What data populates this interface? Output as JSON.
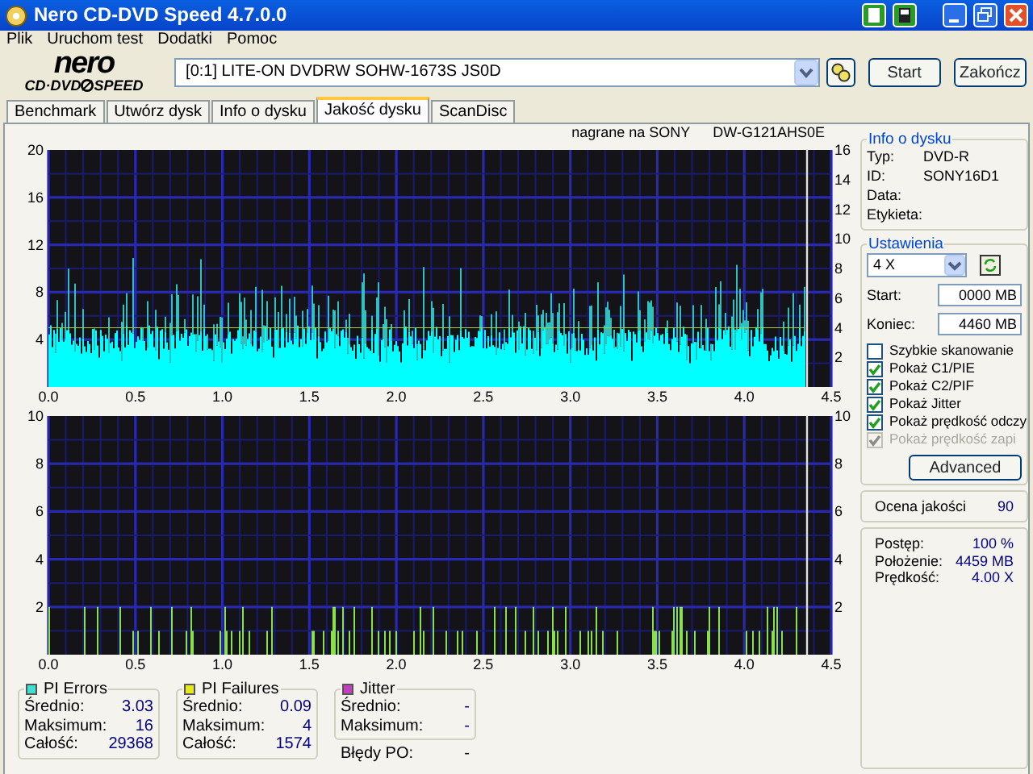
{
  "window": {
    "title": "Nero CD-DVD Speed 4.7.0.0"
  },
  "menu": [
    "Plik",
    "Uruchom test",
    "Dodatki",
    "Pomoc"
  ],
  "logo": {
    "brand": "nero",
    "left": "CD·DVD",
    "right": "SPEED"
  },
  "drive": {
    "value": "[0:1]  LITE-ON DVDRW SOHW-1673S JS0D"
  },
  "buttons": [
    "Start",
    "Zakończ"
  ],
  "tabs": [
    {
      "label": "Benchmark",
      "selected": false
    },
    {
      "label": "Utwórz dysk",
      "selected": false
    },
    {
      "label": "Info o dysku",
      "selected": false
    },
    {
      "label": "Jakość dysku",
      "selected": true
    },
    {
      "label": "ScanDisc",
      "selected": false
    }
  ],
  "chart_caption": [
    "nagrane na SONY",
    "DW-G121AHS0E"
  ],
  "charts": [
    {
      "kind": "errors",
      "left_ticks": [
        "20",
        "16",
        "12",
        "8",
        "4"
      ],
      "right_ticks": [
        "16",
        "14",
        "12",
        "10",
        "8",
        "6",
        "4",
        "2"
      ],
      "x_ticks": [
        "0.0",
        "0.5",
        "1.0",
        "1.5",
        "2.0",
        "2.5",
        "3.0",
        "3.5",
        "4.0",
        "4.5"
      ]
    },
    {
      "kind": "failures",
      "left_ticks": [
        "10",
        "8",
        "6",
        "4",
        "2"
      ],
      "right_ticks": [
        "10",
        "8",
        "6",
        "4",
        "2"
      ],
      "x_ticks": [
        "0.0",
        "0.5",
        "1.0",
        "1.5",
        "2.0",
        "2.5",
        "3.0",
        "3.5",
        "4.0",
        "4.5"
      ]
    }
  ],
  "disc_info": {
    "title": "Info o dysku",
    "rows": [
      {
        "label": "Typ:",
        "value": "DVD-R"
      },
      {
        "label": "ID:",
        "value": "SONY16D1"
      },
      {
        "label": "Data:"
      },
      {
        "label": "Etykieta:"
      }
    ]
  },
  "settings": {
    "title": "Ustawienia",
    "speed": "4 X",
    "start_label": "Start:",
    "start": "0000 MB",
    "end_label": "Koniec:",
    "end": "4460 MB",
    "options": [
      {
        "label": "Szybkie skanowanie",
        "checked": false,
        "disabled": false
      },
      {
        "label": "Pokaż C1/PIE",
        "checked": true,
        "disabled": false
      },
      {
        "label": "Pokaż C2/PIF",
        "checked": true,
        "disabled": false
      },
      {
        "label": "Pokaż Jitter",
        "checked": true,
        "disabled": false
      },
      {
        "label": "Pokaż prędkość odczy",
        "checked": true,
        "disabled": false
      },
      {
        "label": "Pokaż prędkość zapi",
        "checked": true,
        "disabled": true
      }
    ],
    "advanced": "Advanced"
  },
  "quality": {
    "label": "Ocena jakości",
    "value": "90"
  },
  "progress": [
    {
      "label": "Postęp:",
      "value": "100 %"
    },
    {
      "label": "Położenie:",
      "value": "4459 MB"
    },
    {
      "label": "Prędkość:",
      "value": "4.00 X"
    }
  ],
  "stats": [
    {
      "title": "PI Errors",
      "color": "#40e0d0",
      "rows": [
        {
          "label": "Średnio:",
          "value": "3.03"
        },
        {
          "label": "Maksimum:",
          "value": "16"
        },
        {
          "label": "Całość:",
          "value": "29368"
        }
      ]
    },
    {
      "title": "PI Failures",
      "color": "#e8e820",
      "rows": [
        {
          "label": "Średnio:",
          "value": "0.09"
        },
        {
          "label": "Maksimum:",
          "value": "4"
        },
        {
          "label": "Całość:",
          "value": "1574"
        }
      ]
    },
    {
      "title": "Jitter",
      "color": "#c040c0",
      "rows": [
        {
          "label": "Średnio:",
          "value": "-"
        },
        {
          "label": "Maksimum:",
          "value": "-"
        }
      ]
    }
  ],
  "po_errors": {
    "label": "Błędy PO:",
    "value": "-"
  }
}
